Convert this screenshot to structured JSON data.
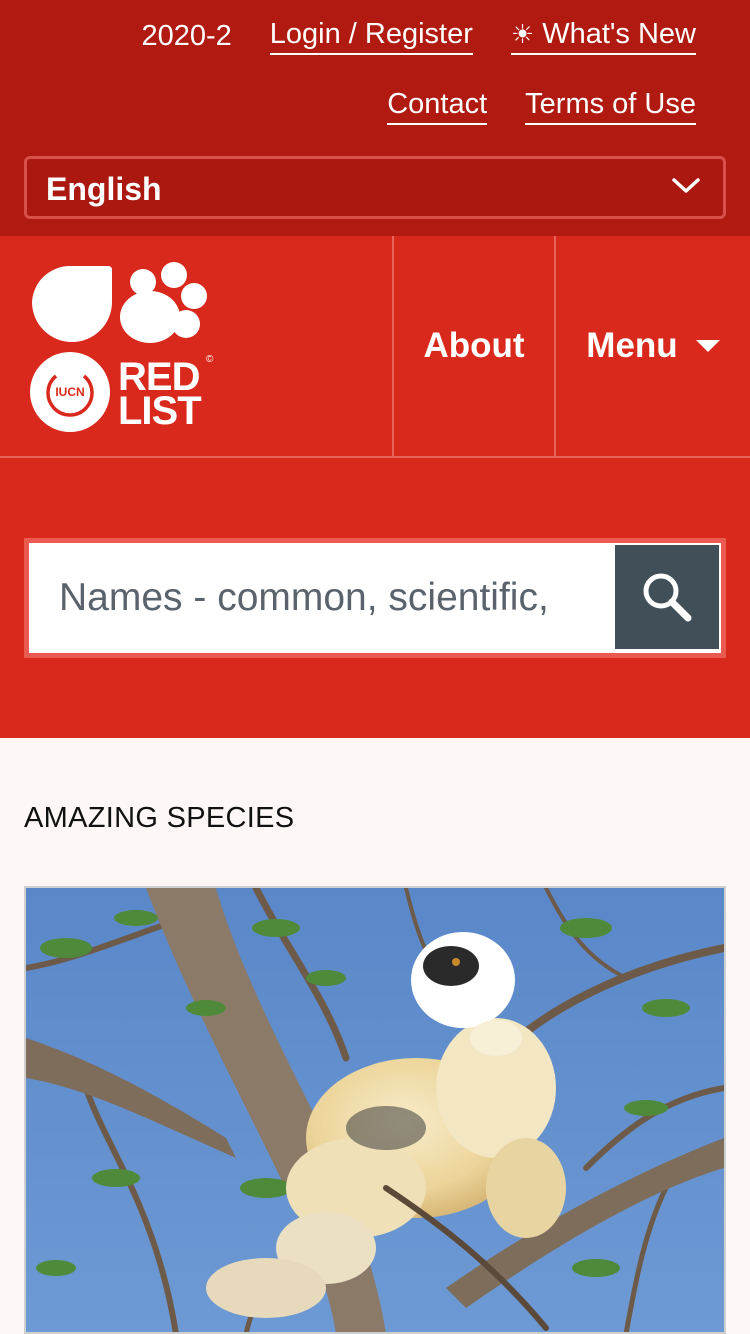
{
  "topbar": {
    "version": "2020-2",
    "login_label": "Login / Register",
    "whats_new_icon": "sun-icon",
    "whats_new_label": "What's New",
    "contact_label": "Contact",
    "terms_label": "Terms of Use",
    "language": {
      "selected": "English",
      "icon": "chevron-down-icon"
    }
  },
  "header": {
    "logo": {
      "badge_text": "IUCN",
      "line1": "RED",
      "line2": "LIST",
      "mark": "©"
    },
    "nav": {
      "about_label": "About",
      "menu_label": "Menu",
      "menu_icon": "caret-down-icon"
    }
  },
  "search": {
    "placeholder": "Names - common, scientific,",
    "button_icon": "search-icon"
  },
  "content": {
    "section_title": "AMAZING SPECIES",
    "featured_image": "lemur-in-tree-photo"
  },
  "colors": {
    "topbar_bg": "#b01a11",
    "header_bg": "#d9291c",
    "search_button_bg": "#414f59",
    "page_bg": "#fdf8f5"
  }
}
